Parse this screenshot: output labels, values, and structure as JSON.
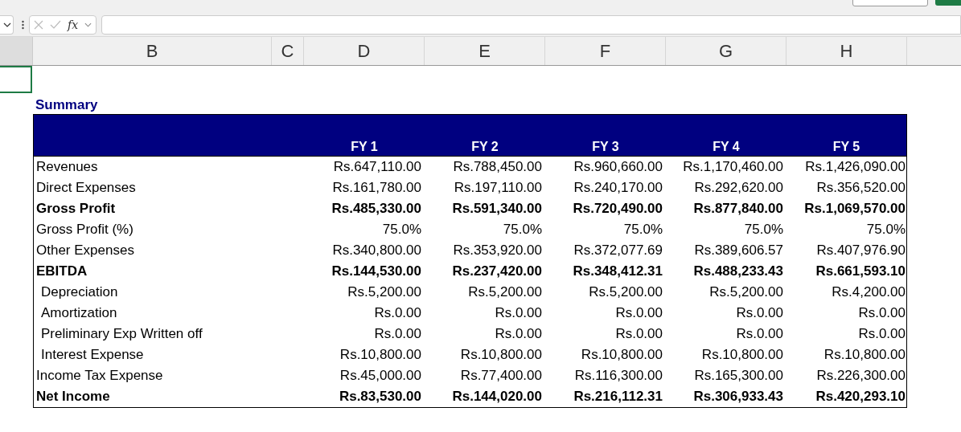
{
  "formula_bar": {
    "fx": "fx"
  },
  "column_headers": [
    "B",
    "C",
    "D",
    "E",
    "F",
    "G",
    "H"
  ],
  "title": "Summary",
  "table": {
    "columns": [
      "FY 1",
      "FY 2",
      "FY 3",
      "FY 4",
      "FY 5"
    ],
    "rows": [
      {
        "label": "Revenues",
        "kind": "plain",
        "values": [
          "Rs.647,110.00",
          "Rs.788,450.00",
          "Rs.960,660.00",
          "Rs.1,170,460.00",
          "Rs.1,426,090.00"
        ]
      },
      {
        "label": "Direct Expenses",
        "kind": "plain",
        "values": [
          "Rs.161,780.00",
          "Rs.197,110.00",
          "Rs.240,170.00",
          "Rs.292,620.00",
          "Rs.356,520.00"
        ]
      },
      {
        "label": "Gross Profit",
        "kind": "bold",
        "values": [
          "Rs.485,330.00",
          "Rs.591,340.00",
          "Rs.720,490.00",
          "Rs.877,840.00",
          "Rs.1,069,570.00"
        ]
      },
      {
        "label": "Gross Profit (%)",
        "kind": "plain",
        "values": [
          "75.0%",
          "75.0%",
          "75.0%",
          "75.0%",
          "75.0%"
        ]
      },
      {
        "label": "Other Expenses",
        "kind": "plain",
        "values": [
          "Rs.340,800.00",
          "Rs.353,920.00",
          "Rs.372,077.69",
          "Rs.389,606.57",
          "Rs.407,976.90"
        ]
      },
      {
        "label": "EBITDA",
        "kind": "bold",
        "values": [
          "Rs.144,530.00",
          "Rs.237,420.00",
          "Rs.348,412.31",
          "Rs.488,233.43",
          "Rs.661,593.10"
        ]
      },
      {
        "label": "Depreciation",
        "kind": "indent",
        "values": [
          "Rs.5,200.00",
          "Rs.5,200.00",
          "Rs.5,200.00",
          "Rs.5,200.00",
          "Rs.4,200.00"
        ]
      },
      {
        "label": "Amortization",
        "kind": "indent",
        "values": [
          "Rs.0.00",
          "Rs.0.00",
          "Rs.0.00",
          "Rs.0.00",
          "Rs.0.00"
        ]
      },
      {
        "label": "Preliminary Exp Written off",
        "kind": "indent",
        "values": [
          "Rs.0.00",
          "Rs.0.00",
          "Rs.0.00",
          "Rs.0.00",
          "Rs.0.00"
        ]
      },
      {
        "label": "Interest Expense",
        "kind": "indent",
        "values": [
          "Rs.10,800.00",
          "Rs.10,800.00",
          "Rs.10,800.00",
          "Rs.10,800.00",
          "Rs.10,800.00"
        ]
      },
      {
        "label": "Income Tax Expense",
        "kind": "plain",
        "values": [
          "Rs.45,000.00",
          "Rs.77,400.00",
          "Rs.116,300.00",
          "Rs.165,300.00",
          "Rs.226,300.00"
        ]
      },
      {
        "label": "Net Income",
        "kind": "bold",
        "values": [
          "Rs.83,530.00",
          "Rs.144,020.00",
          "Rs.216,112.31",
          "Rs.306,933.43",
          "Rs.420,293.10"
        ]
      }
    ]
  }
}
